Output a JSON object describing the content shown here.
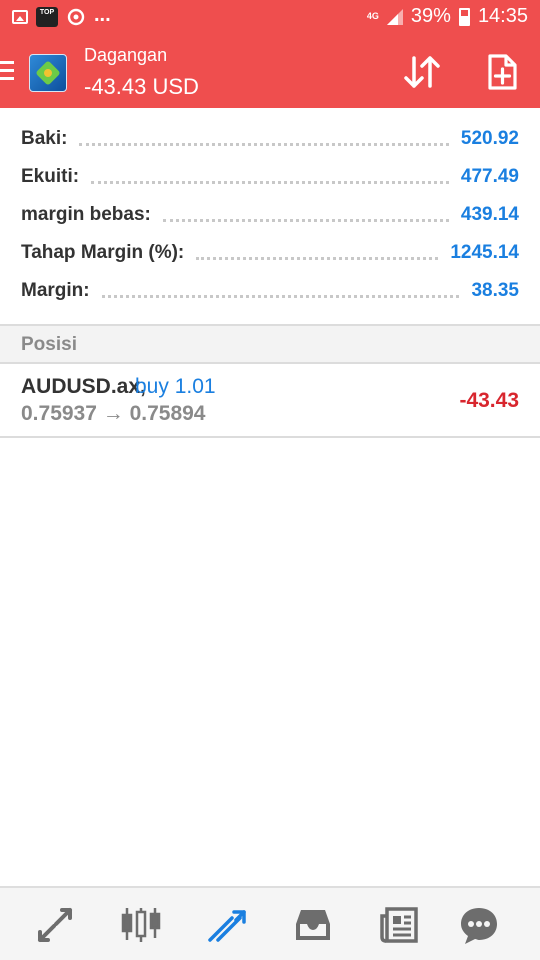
{
  "status_bar": {
    "dots": "...",
    "network": "4G",
    "battery": "39%",
    "time": "14:35",
    "icons": [
      "gallery-icon",
      "top-app-icon",
      "sync-icon",
      "signal-icon",
      "battery-icon"
    ],
    "top_badge": "TOP"
  },
  "app_bar": {
    "title": "Dagangan",
    "subtitle": "-43.43 USD",
    "icons": [
      "menu-icon",
      "metatrader-logo",
      "sort-icon",
      "new-order-icon"
    ]
  },
  "summary": [
    {
      "label": "Baki:",
      "value": "520.92"
    },
    {
      "label": "Ekuiti:",
      "value": "477.49"
    },
    {
      "label": "margin bebas:",
      "value": "439.14"
    },
    {
      "label": "Tahap Margin (%):",
      "value": "1245.14"
    },
    {
      "label": "Margin:",
      "value": "38.35"
    }
  ],
  "positions_header": "Posisi",
  "position": {
    "symbol": "AUDUSD.ax,",
    "side": "buy 1.01",
    "prices": "0.75937 → 0.75894",
    "profit": "-43.43"
  },
  "bottom_nav": [
    "quotes-icon",
    "chart-icon",
    "trade-icon",
    "history-icon",
    "news-icon",
    "chat-icon"
  ],
  "colors": {
    "header": "#ef4e4e",
    "value_blue": "#1a7fe0",
    "loss_red": "#d8262e",
    "active_tab": "#1a7fe0",
    "inactive_tab": "#6d6d6d"
  }
}
